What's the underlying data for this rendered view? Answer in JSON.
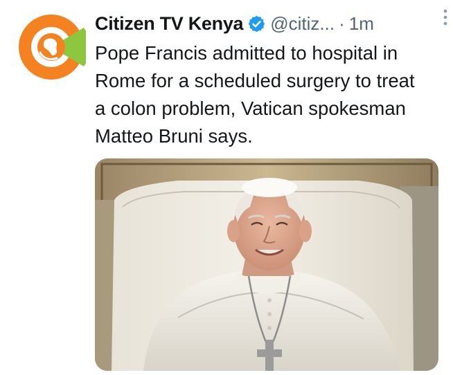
{
  "tweet": {
    "display_name": "Citizen TV Kenya",
    "handle": "@citiz...",
    "separator": "·",
    "time": "1m",
    "text": "Pope Francis admitted to hospital in Rome for a scheduled surgery to treat a colon problem, Vatican spokesman Matteo Bruni says.",
    "icons": {
      "avatar": "citizen-tv-logo",
      "verified": "verified-badge-icon",
      "more": "more-options-icon"
    }
  },
  "colors": {
    "verified_blue": "#1d9bf0",
    "logo_orange": "#f58220",
    "logo_green": "#8dc63f",
    "text_primary": "#14171a",
    "text_secondary": "#536471"
  }
}
